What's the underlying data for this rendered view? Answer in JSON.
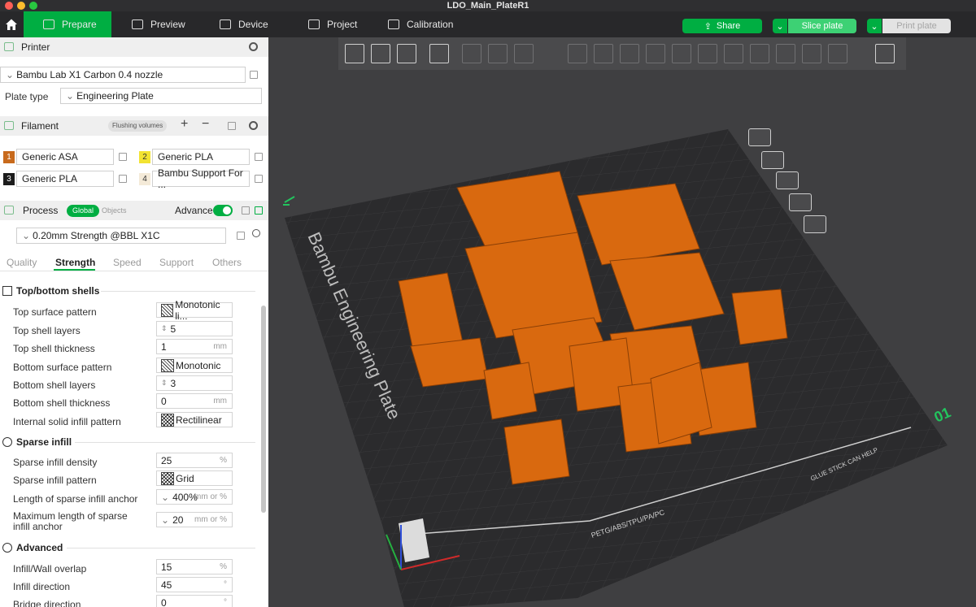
{
  "window": {
    "title": "LDO_Main_PlateR1"
  },
  "colors": {
    "accent": "#00ae42",
    "part": "#d9690f",
    "bed": "#2b2b2d"
  },
  "nav": {
    "tabs": [
      {
        "label": "Prepare",
        "icon": "cube-icon"
      },
      {
        "label": "Preview",
        "icon": "layers-icon"
      },
      {
        "label": "Device",
        "icon": "monitor-icon"
      },
      {
        "label": "Project",
        "icon": "document-icon"
      },
      {
        "label": "Calibration",
        "icon": "calibration-icon"
      }
    ],
    "share": "Share",
    "slice": "Slice plate",
    "print": "Print plate"
  },
  "printer": {
    "title": "Printer",
    "model": "Bambu Lab X1 Carbon 0.4 nozzle",
    "plate_label": "Plate type",
    "plate_value": "Engineering Plate"
  },
  "filament": {
    "title": "Filament",
    "flushing": "Flushing volumes",
    "items": [
      {
        "num": "1",
        "name": "Generic ASA",
        "color": "#c86a1c"
      },
      {
        "num": "2",
        "name": "Generic PLA",
        "color": "#f2e332"
      },
      {
        "num": "3",
        "name": "Generic PLA",
        "color": "#1c1c1c"
      },
      {
        "num": "4",
        "name": "Bambu Support For ...",
        "color": "#f4ead8"
      }
    ]
  },
  "process": {
    "title": "Process",
    "global": "Global",
    "objects": "Objects",
    "advance": "Advance",
    "preset": "0.20mm Strength @BBL X1C",
    "tabs": [
      "Quality",
      "Strength",
      "Speed",
      "Support",
      "Others"
    ],
    "active_tab": "Strength"
  },
  "settings": {
    "top_bottom": {
      "title": "Top/bottom shells",
      "top_surface_pattern": {
        "label": "Top surface pattern",
        "value": "Monotonic li..."
      },
      "top_shell_layers": {
        "label": "Top shell layers",
        "value": "5"
      },
      "top_shell_thickness": {
        "label": "Top shell thickness",
        "value": "1",
        "unit": "mm"
      },
      "bottom_surface_pattern": {
        "label": "Bottom surface pattern",
        "value": "Monotonic"
      },
      "bottom_shell_layers": {
        "label": "Bottom shell layers",
        "value": "3"
      },
      "bottom_shell_thickness": {
        "label": "Bottom shell thickness",
        "value": "0",
        "unit": "mm"
      },
      "internal_solid_infill": {
        "label": "Internal solid infill pattern",
        "value": "Rectilinear"
      }
    },
    "sparse": {
      "title": "Sparse infill",
      "density": {
        "label": "Sparse infill density",
        "value": "25",
        "unit": "%"
      },
      "pattern": {
        "label": "Sparse infill pattern",
        "value": "Grid"
      },
      "anchor": {
        "label": "Length of sparse infill anchor",
        "value": "400%",
        "unit": "mm or %"
      },
      "max_anchor": {
        "label": "Maximum length of sparse infill anchor",
        "value": "20",
        "unit": "mm or %"
      }
    },
    "advanced": {
      "title": "Advanced",
      "overlap": {
        "label": "Infill/Wall overlap",
        "value": "15",
        "unit": "%"
      },
      "direction": {
        "label": "Infill direction",
        "value": "45",
        "unit": "°"
      },
      "bridge": {
        "label": "Bridge direction",
        "value": "0",
        "unit": "°"
      }
    }
  },
  "viewport": {
    "plate_name": "Bambu Engineering Plate",
    "plate_number": "01",
    "glue_note": "GLUE STICK CAN HELP",
    "materials": "PETG/ABS/TPU/PA/PC"
  }
}
